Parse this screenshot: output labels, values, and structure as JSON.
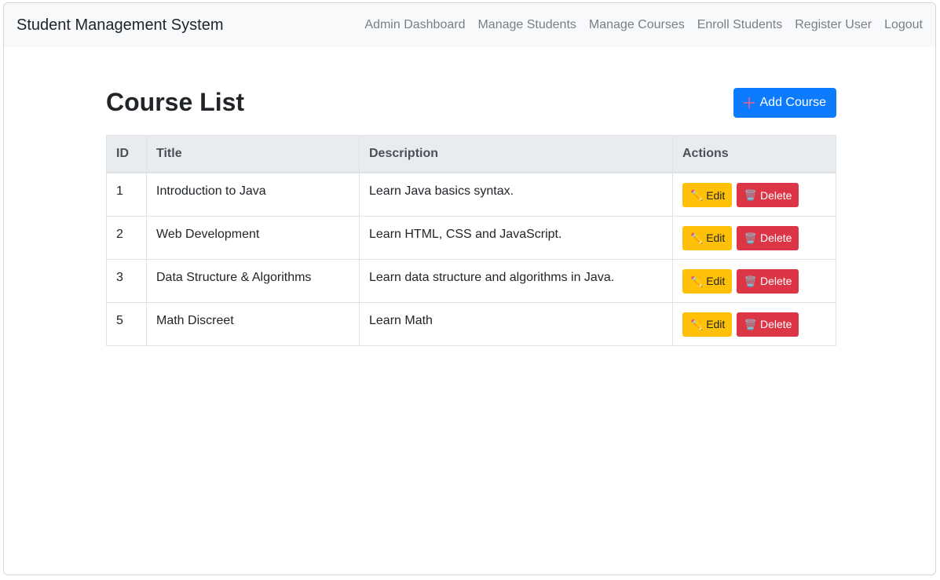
{
  "navbar": {
    "brand": "Student Management System",
    "links": [
      {
        "label": "Admin Dashboard"
      },
      {
        "label": "Manage Students"
      },
      {
        "label": "Manage Courses"
      },
      {
        "label": "Enroll Students"
      },
      {
        "label": "Register User"
      },
      {
        "label": "Logout"
      }
    ]
  },
  "page": {
    "title": "Course List",
    "add_button_label": "Add Course",
    "add_button_icon": "plus-icon"
  },
  "table": {
    "headers": [
      "ID",
      "Title",
      "Description",
      "Actions"
    ],
    "rows": [
      {
        "id": "1",
        "title": "Introduction to Java",
        "description": "Learn Java basics syntax.",
        "edit_label": "Edit",
        "delete_label": "Delete"
      },
      {
        "id": "2",
        "title": "Web Development",
        "description": "Learn HTML, CSS and JavaScript.",
        "edit_label": "Edit",
        "delete_label": "Delete"
      },
      {
        "id": "3",
        "title": "Data Structure & Algorithms",
        "description": "Learn data structure and algorithms in Java.",
        "edit_label": "Edit",
        "delete_label": "Delete"
      },
      {
        "id": "5",
        "title": "Math Discreet",
        "description": "Learn Math",
        "edit_label": "Edit",
        "delete_label": "Delete"
      }
    ]
  },
  "colors": {
    "navbar_bg": "#f8f9fa",
    "primary": "#0d7bfd",
    "warning": "#ffc107",
    "danger": "#dc3545",
    "table_header_bg": "#e9ecef"
  },
  "icons": {
    "edit": "pencil-icon",
    "delete": "trash-icon"
  }
}
